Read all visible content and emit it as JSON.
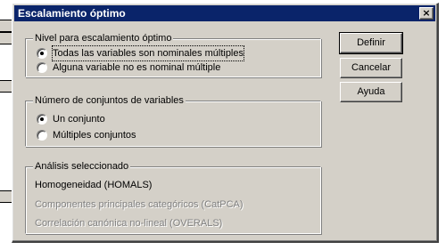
{
  "dialog": {
    "title": "Escalamiento óptimo",
    "close_glyph": "×"
  },
  "nivel": {
    "legend": "Nivel para escalamiento óptimo",
    "options": [
      {
        "label": "Todas las variables son nominales múltiples",
        "checked": true
      },
      {
        "label": "Alguna variable no es nominal múltiple",
        "checked": false
      }
    ]
  },
  "conjuntos": {
    "legend": "Número de conjuntos de variables",
    "options": [
      {
        "label": "Un conjunto",
        "checked": true
      },
      {
        "label": "Múltiples conjuntos",
        "checked": false
      }
    ]
  },
  "analisis": {
    "legend": "Análisis seleccionado",
    "items": [
      {
        "label": "Homogeneidad (HOMALS)",
        "enabled": true
      },
      {
        "label": "Componentes principales categóricos (CatPCA)",
        "enabled": false
      },
      {
        "label": "Correlación canónica no-lineal (OVERALS)",
        "enabled": false
      }
    ]
  },
  "buttons": {
    "definir": "Definir",
    "cancelar": "Cancelar",
    "ayuda": "Ayuda"
  }
}
